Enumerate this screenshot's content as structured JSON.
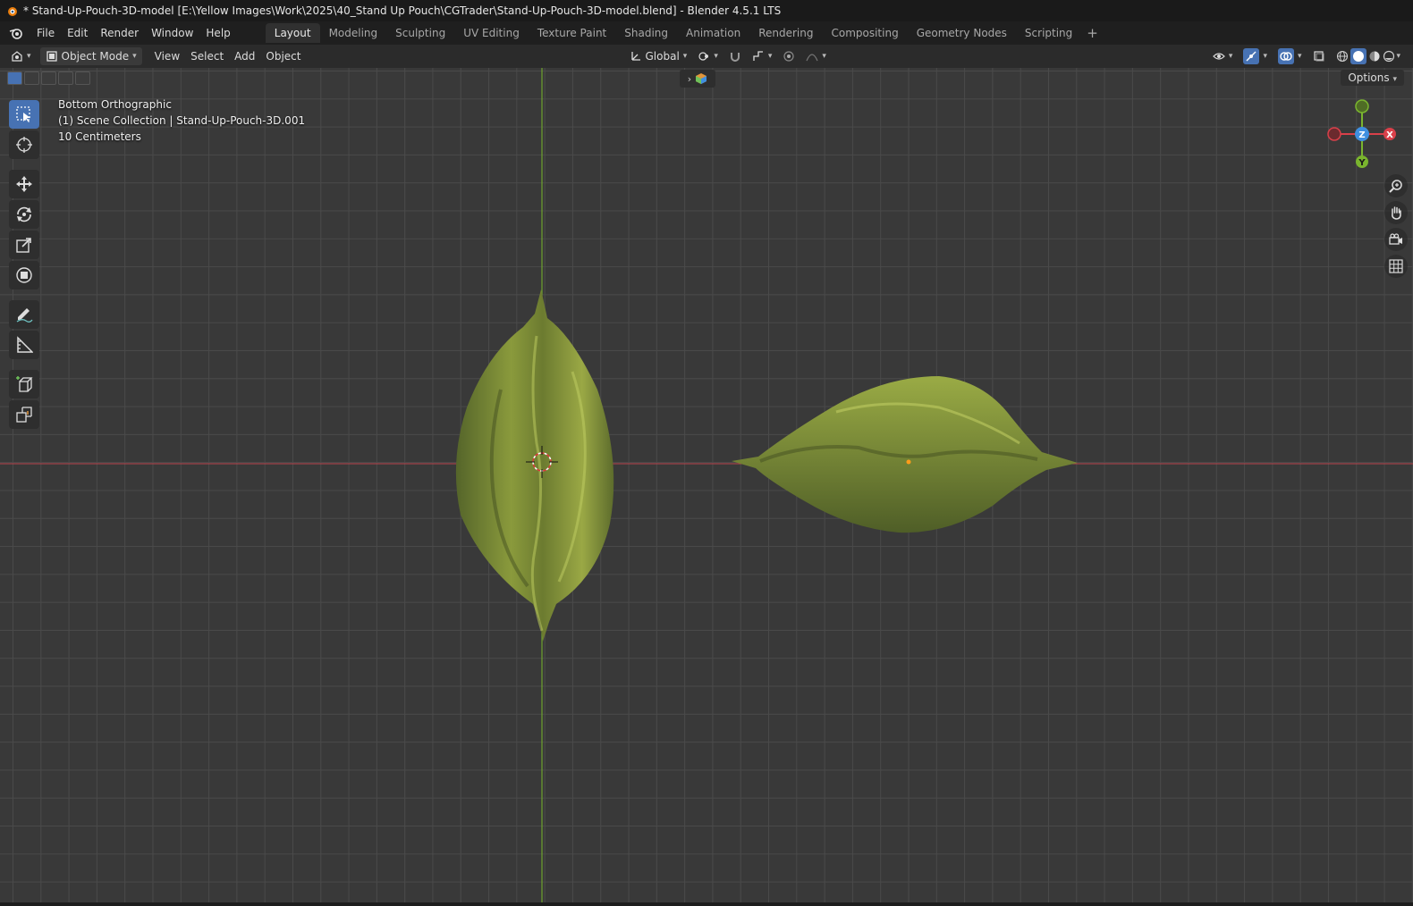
{
  "window": {
    "title": "* Stand-Up-Pouch-3D-model [E:\\Yellow Images\\Work\\2025\\40_Stand Up Pouch\\CGTrader\\Stand-Up-Pouch-3D-model.blend] - Blender 4.5.1 LTS"
  },
  "menu": {
    "items": [
      "File",
      "Edit",
      "Render",
      "Window",
      "Help"
    ]
  },
  "workspaces": {
    "tabs": [
      "Layout",
      "Modeling",
      "Sculpting",
      "UV Editing",
      "Texture Paint",
      "Shading",
      "Animation",
      "Rendering",
      "Compositing",
      "Geometry Nodes",
      "Scripting"
    ],
    "active": "Layout",
    "add_label": "+"
  },
  "header": {
    "mode": "Object Mode",
    "view": "View",
    "select": "Select",
    "add": "Add",
    "object": "Object",
    "transform_orientation": "Global",
    "options": "Options"
  },
  "viewport": {
    "view_name": "Bottom Orthographic",
    "collection_info": "(1) Scene Collection | Stand-Up-Pouch-3D.001",
    "grid_scale": "10 Centimeters"
  },
  "gizmo": {
    "axis_z": "Z",
    "axis_x": "X",
    "axis_y": "Y",
    "color_x": "#d9404a",
    "color_y": "#7ab52e",
    "color_z": "#3f8fe0"
  },
  "colors": {
    "accent": "#4772b3",
    "pouch": "#7c8a35",
    "x_axis_line": "#b8424a",
    "y_axis_line": "#6ea32f"
  }
}
